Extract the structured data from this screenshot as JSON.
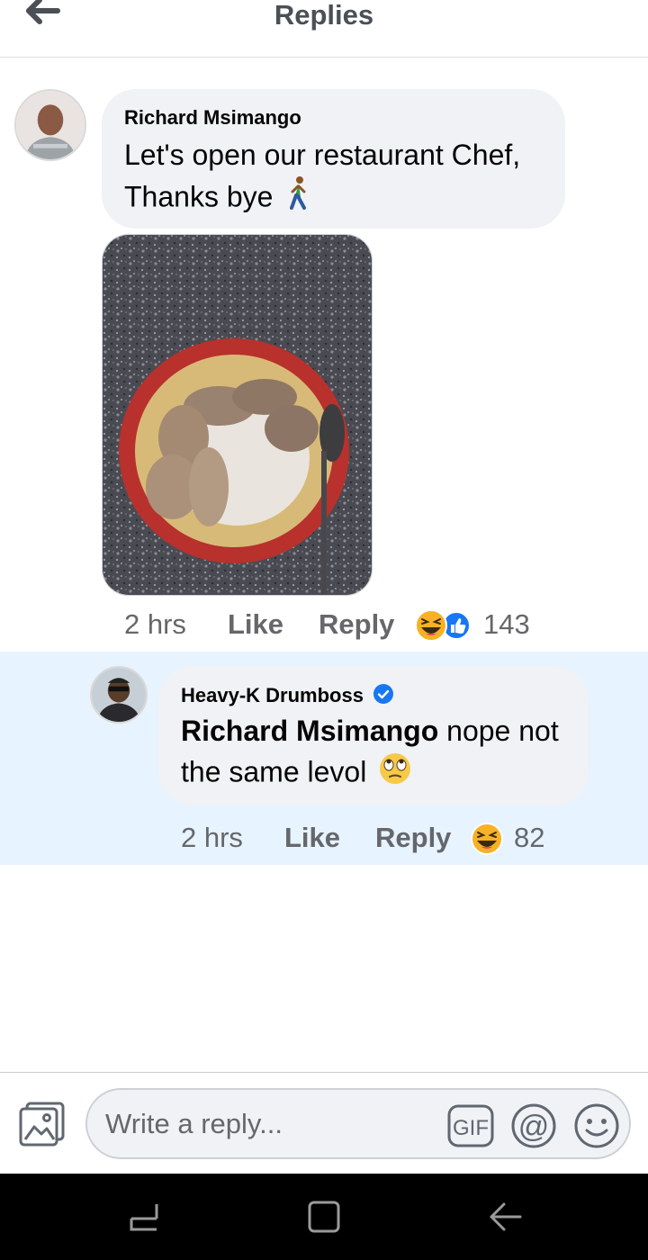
{
  "header": {
    "title": "Replies",
    "back_icon": "arrow-left-icon"
  },
  "comment": {
    "author": "Richard Msimango",
    "text": "Let's open our restaurant Chef, Thanks bye",
    "emoji": "walking-person-emoji",
    "photo": "plate of chicken and pap on granite counter",
    "time": "2 hrs",
    "like_label": "Like",
    "reply_label": "Reply",
    "reactions": [
      "haha",
      "like"
    ],
    "reaction_count": "143"
  },
  "reply": {
    "author": "Heavy-K Drumboss",
    "verified": true,
    "mention": "Richard Msimango",
    "text": " nope not the same levol",
    "emoji": "eye-roll-emoji",
    "time": "2 hrs",
    "like_label": "Like",
    "reply_label": "Reply",
    "reactions": [
      "haha"
    ],
    "reaction_count": "82",
    "highlight_color": "#e7f3ff"
  },
  "composer": {
    "placeholder": "Write a reply...",
    "gif_label": "GIF",
    "mention_label": "@",
    "icons": [
      "photo-icon",
      "gif-icon",
      "mention-icon",
      "emoji-icon"
    ]
  },
  "navbar": {
    "icons": [
      "recent-apps-icon",
      "home-icon",
      "back-icon"
    ]
  },
  "colors": {
    "bubble": "#f0f2f5",
    "meta": "#65676b",
    "verified": "#1877f2",
    "like_blue": "#1877f2",
    "haha_yellow": "#f7b125"
  }
}
